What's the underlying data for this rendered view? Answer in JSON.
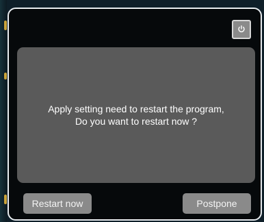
{
  "dialog": {
    "message_line1": "Apply setting need to restart the program,",
    "message_line2": "Do you want to restart now ?",
    "restart_label": "Restart now",
    "postpone_label": "Postpone",
    "power_icon": "power-icon"
  },
  "colors": {
    "dialog_background": "#06090b",
    "panel_background": "#5a5a5a",
    "button_background": "#8a8a8a",
    "text": "#ffffff"
  }
}
